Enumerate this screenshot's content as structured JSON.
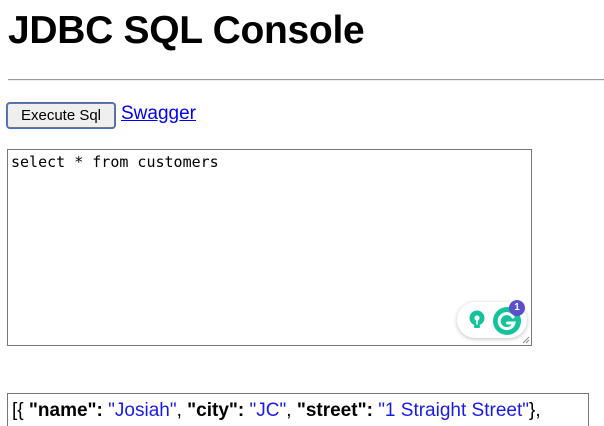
{
  "page": {
    "title": "JDBC SQL Console"
  },
  "toolbar": {
    "execute_label": "Execute Sql",
    "swagger_label": "Swagger"
  },
  "editor": {
    "query": "select * from customers"
  },
  "assistant": {
    "bulb_icon": "lightbulb-icon",
    "logo_icon": "grammarly-g-icon",
    "badge_count": "1",
    "accent_color": "#15c39a",
    "badge_color": "#5a4fcf"
  },
  "result": {
    "open_bracket": "[{",
    "fields": [
      {
        "key": "\"name\":",
        "value": "\"Josiah\"",
        "sep": ","
      },
      {
        "key": "\"city\":",
        "value": "\"JC\"",
        "sep": ","
      },
      {
        "key": "\"street\":",
        "value": "\"1 Straight Street\"",
        "sep": "},"
      }
    ],
    "string_color": "#1a1ae6"
  }
}
